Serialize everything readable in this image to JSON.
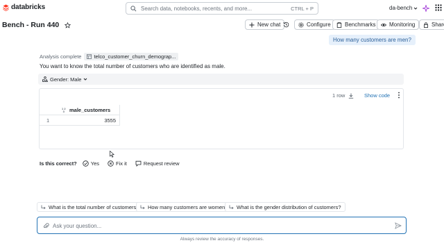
{
  "brand": {
    "name": "databricks",
    "color": "#ff3621"
  },
  "search": {
    "placeholder": "Search data, notebooks, recents, and more...",
    "shortcut": "CTRL + P"
  },
  "workspace": {
    "name": "da-bench"
  },
  "page": {
    "title": "Bench - Run 440"
  },
  "toolbar": {
    "new_chat": "New chat",
    "configure": "Configure",
    "benchmarks": "Benchmarks",
    "monitoring": "Monitoring",
    "share": "Share"
  },
  "user_message": "How many customers are men?",
  "answer": {
    "status": "Analysis complete",
    "table": "telco_customer_churn_demograp...",
    "text": "You want to know the total number of customers who are identified as male.",
    "filter_label": "Gender: Male"
  },
  "result": {
    "row_count": "1 row",
    "show_code": "Show code",
    "column": "male_customers",
    "rows": [
      {
        "index": "1",
        "value": "3555"
      }
    ]
  },
  "feedback": {
    "question": "Is this correct?",
    "yes": "Yes",
    "fix": "Fix it",
    "review": "Request review"
  },
  "suggestions": [
    "What is the total number of customers?",
    "How many customers are women?",
    "What is the gender distribution of customers?"
  ],
  "ask": {
    "placeholder": "Ask your question..."
  },
  "disclaimer": "Always review the accuracy of responses.",
  "colors": {
    "accent": "#2272b4",
    "bubble": "#e6f0fb",
    "sparkle": "#a23bd8"
  }
}
